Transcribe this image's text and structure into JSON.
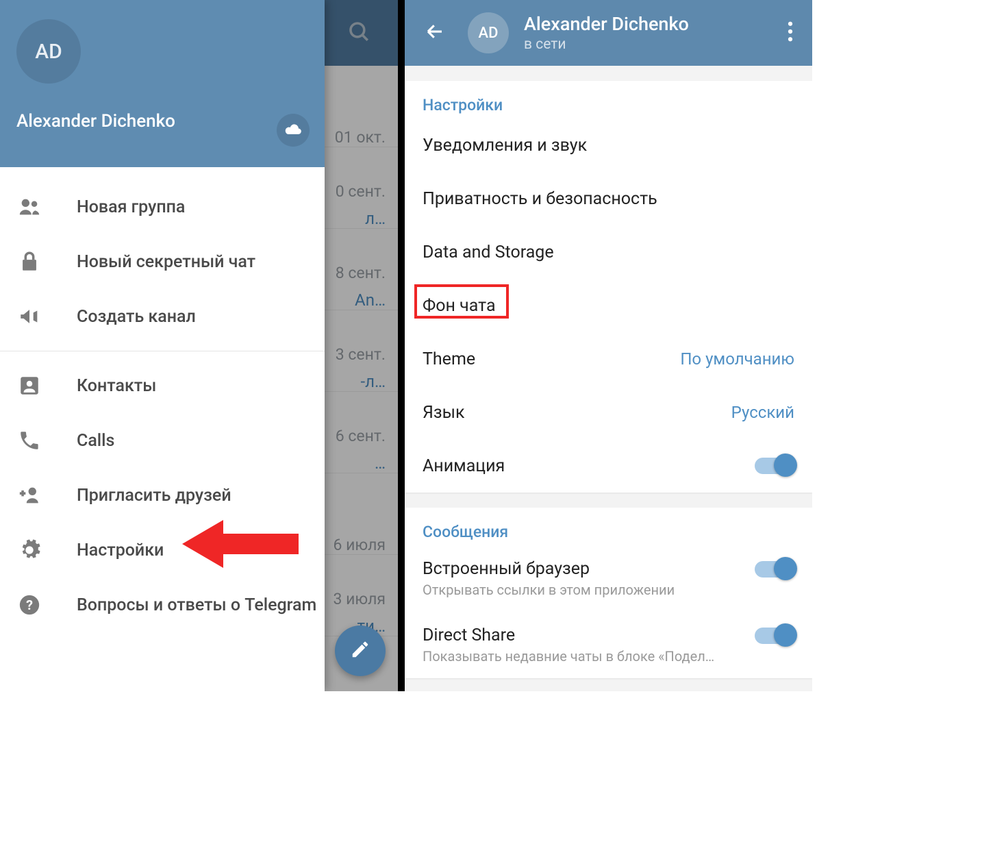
{
  "left": {
    "avatar_initials": "AD",
    "user_name": "Alexander Dichenko",
    "menu": {
      "new_group": "Новая группа",
      "new_secret_chat": "Новый секретный чат",
      "new_channel": "Создать канал",
      "contacts": "Контакты",
      "calls": "Calls",
      "invite": "Пригласить друзей",
      "settings": "Настройки",
      "faq": "Вопросы и ответы о Telegram"
    },
    "chats": [
      {
        "date": "01 окт."
      },
      {
        "date": "0 сент.",
        "name_frag": "л…"
      },
      {
        "date": "8 сент.",
        "name_frag": "An…"
      },
      {
        "date": "3 сент.",
        "name_frag": "-л…"
      },
      {
        "date": "6 сент.",
        "name_frag": "…"
      },
      {
        "date": "6 июля",
        "name_frag": ""
      },
      {
        "date": "3 июля",
        "name_frag": "ти…"
      }
    ]
  },
  "right": {
    "avatar_initials": "AD",
    "title": "Alexander Dichenko",
    "status": "в сети",
    "section_settings_title": "Настройки",
    "rows": {
      "notifications": "Уведомления и звук",
      "privacy": "Приватность и безопасность",
      "data_storage": "Data and Storage",
      "chat_bg": "Фон чата",
      "theme": "Theme",
      "theme_value": "По умолчанию",
      "language": "Язык",
      "language_value": "Русский",
      "animation": "Анимация"
    },
    "section_messages_title": "Сообщения",
    "msg_rows": {
      "in_app_browser": "Встроенный браузер",
      "in_app_browser_sub": "Открывать ссылки в этом приложении",
      "direct_share": "Direct Share",
      "direct_share_sub": "Показывать недавние чаты в блоке «Подел…"
    }
  }
}
